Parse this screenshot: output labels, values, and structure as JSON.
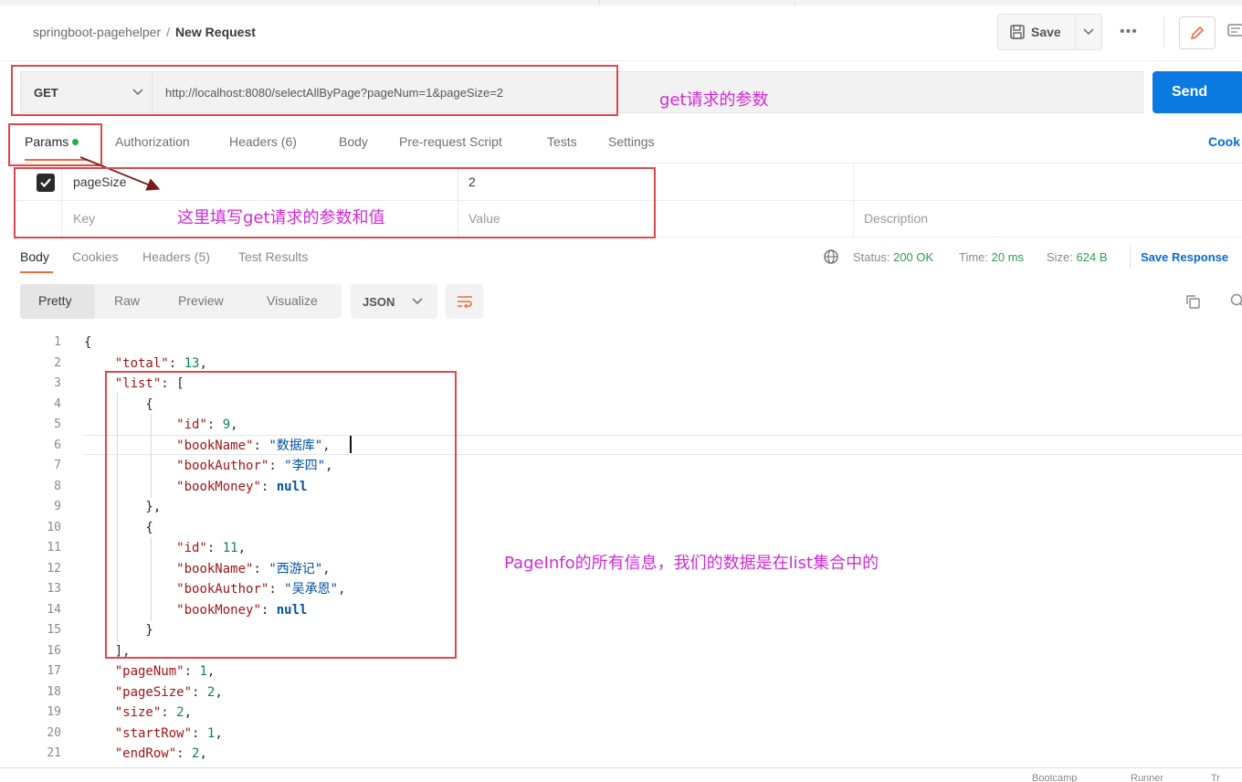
{
  "header": {
    "collection": "springboot-pagehelper",
    "separator": "/",
    "request_name": "New Request",
    "save_label": "Save",
    "more_label": "•••"
  },
  "request": {
    "method": "GET",
    "url": "http://localhost:8080/selectAllByPage?pageNum=1&pageSize=2",
    "send_label": "Send"
  },
  "request_tabs": [
    {
      "label": "Params"
    },
    {
      "label": "Authorization"
    },
    {
      "label": "Headers (6)"
    },
    {
      "label": "Body"
    },
    {
      "label": "Pre-request Script"
    },
    {
      "label": "Tests"
    },
    {
      "label": "Settings"
    }
  ],
  "cookies_link": "Cook",
  "params": {
    "rows": [
      {
        "checked": true,
        "key": "pageSize",
        "value": "2"
      }
    ],
    "placeholders": {
      "key": "Key",
      "value": "Value",
      "description": "Description"
    }
  },
  "response_tabs": [
    {
      "label": "Body"
    },
    {
      "label": "Cookies"
    },
    {
      "label": "Headers (5)"
    },
    {
      "label": "Test Results"
    }
  ],
  "status": {
    "status_label": "Status:",
    "status_value": "200 OK",
    "time_label": "Time:",
    "time_value": "20 ms",
    "size_label": "Size:",
    "size_value": "624 B",
    "save_response": "Save Response"
  },
  "view_options": [
    "Pretty",
    "Raw",
    "Preview",
    "Visualize"
  ],
  "format": "JSON",
  "code_lines": [
    {
      "n": "1",
      "t": "{"
    },
    {
      "n": "2",
      "t": "    \"total\": 13,"
    },
    {
      "n": "3",
      "t": "    \"list\": ["
    },
    {
      "n": "4",
      "t": "        {"
    },
    {
      "n": "5",
      "t": "            \"id\": 9,"
    },
    {
      "n": "6",
      "t": "            \"bookName\": \"数据库\","
    },
    {
      "n": "7",
      "t": "            \"bookAuthor\": \"李四\","
    },
    {
      "n": "8",
      "t": "            \"bookMoney\": null"
    },
    {
      "n": "9",
      "t": "        },"
    },
    {
      "n": "10",
      "t": "        {"
    },
    {
      "n": "11",
      "t": "            \"id\": 11,"
    },
    {
      "n": "12",
      "t": "            \"bookName\": \"西游记\","
    },
    {
      "n": "13",
      "t": "            \"bookAuthor\": \"吴承恩\","
    },
    {
      "n": "14",
      "t": "            \"bookMoney\": null"
    },
    {
      "n": "15",
      "t": "        }"
    },
    {
      "n": "16",
      "t": "    ],"
    },
    {
      "n": "17",
      "t": "    \"pageNum\": 1,"
    },
    {
      "n": "18",
      "t": "    \"pageSize\": 2,"
    },
    {
      "n": "19",
      "t": "    \"size\": 2,"
    },
    {
      "n": "20",
      "t": "    \"startRow\": 1,"
    },
    {
      "n": "21",
      "t": "    \"endRow\": 2,"
    }
  ],
  "annotations": {
    "url_note": "get请求的参数",
    "params_note": "这里填写get请求的参数和值",
    "list_note": "PageInfo的所有信息，我们的数据是在list集合中的"
  },
  "colors": {
    "accent_orange": "#f26b3a",
    "send_blue": "#0b7ae0",
    "annotation_magenta": "#d12ad7",
    "annotation_red": "#e0474c"
  },
  "footer": {
    "left": "Bootcamp",
    "mid": "Runner",
    "right": "Tr"
  }
}
